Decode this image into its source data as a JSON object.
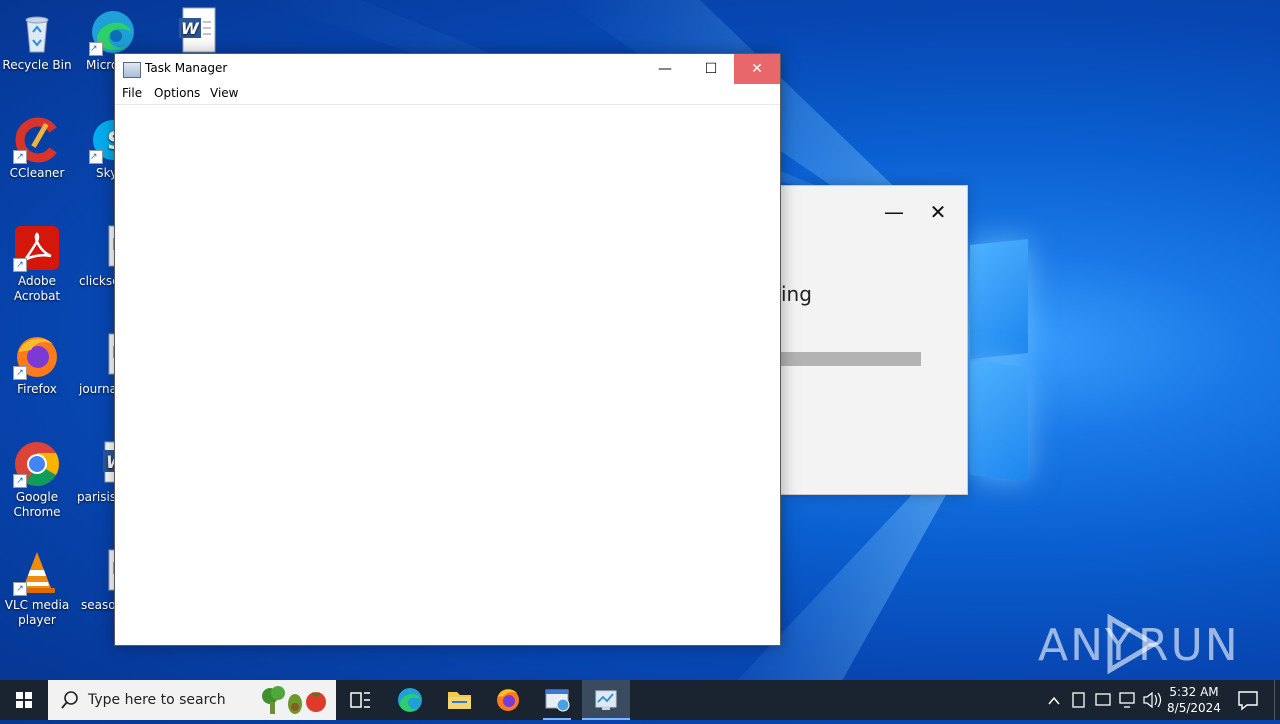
{
  "desktop": {
    "icons": [
      {
        "label": "Recycle Bin",
        "icon": "recycle-bin-icon"
      },
      {
        "label": "CCleaner",
        "icon": "ccleaner-icon"
      },
      {
        "label": "Adobe Acrobat",
        "icon": "adobe-acrobat-icon"
      },
      {
        "label": "Firefox",
        "icon": "firefox-icon"
      },
      {
        "label": "Google Chrome",
        "icon": "chrome-icon"
      },
      {
        "label": "VLC media player",
        "icon": "vlc-icon"
      },
      {
        "label": "Micro Ed",
        "icon": "edge-icon"
      },
      {
        "label": "Sky",
        "icon": "skype-icon"
      },
      {
        "label": "clickse",
        "icon": "image-file-icon"
      },
      {
        "label": "journa",
        "icon": "image-file-icon"
      },
      {
        "label": "parisiss",
        "icon": "word-doc-icon"
      },
      {
        "label": "seasor",
        "icon": "image-file-icon"
      },
      {
        "label": "",
        "icon": "word-doc-icon"
      }
    ]
  },
  "background_dialog": {
    "minimize_glyph": "—",
    "close_glyph": "✕",
    "message": "ing"
  },
  "task_manager": {
    "title": "Task Manager",
    "minimize_glyph": "—",
    "maximize_glyph": "☐",
    "close_glyph": "✕",
    "menu": [
      "File",
      "Options",
      "View"
    ]
  },
  "watermark": {
    "text": "ANY RUN"
  },
  "taskbar": {
    "search_placeholder": "Type here to search",
    "clock_time": "5:32 AM",
    "clock_date": "8/5/2024"
  },
  "colors": {
    "taskbar": "#1a2330",
    "close_button": "#e8676a",
    "accent": "#0a5fd0"
  }
}
